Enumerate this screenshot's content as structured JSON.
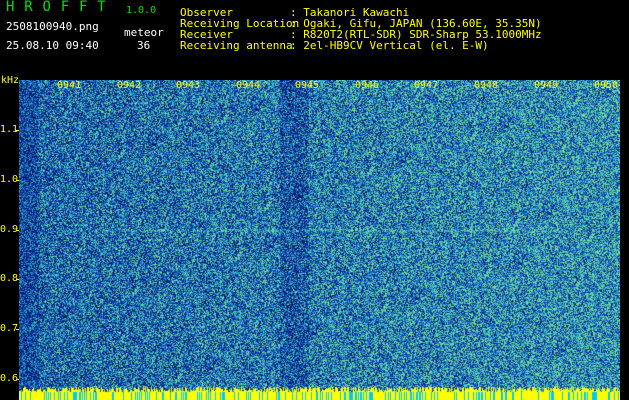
{
  "app": {
    "title": "H R O F F T",
    "version": "1.0.0",
    "filename": "2508100940.png",
    "datetime": "25.08.10 09:40",
    "meteor_label": "meteor",
    "meteor_count": "36"
  },
  "info": [
    {
      "label": "Observer",
      "value": ": Takanori Kawachi"
    },
    {
      "label": "Receiving Location",
      "value": ": Ogaki, Gifu, JAPAN (136.60E, 35.35N)"
    },
    {
      "label": "Receiver",
      "value": ": R820T2(RTL-SDR) SDR-Sharp 53.1000MHz"
    },
    {
      "label": "Receiving antenna",
      "value": ": 2el-HB9CV Vertical (el. E-W)"
    }
  ],
  "axis": {
    "unit": "kHz",
    "y_ticks": [
      "1.1",
      "1.0",
      "0.9",
      "0.8",
      "0.7",
      "0.6"
    ],
    "x_ticks": [
      "0941",
      "0942",
      "0943",
      "0944",
      "0945",
      "0946",
      "0947",
      "0948",
      "0949",
      "0950"
    ]
  },
  "colors": {
    "background": "#000000",
    "header_green": "#00e000",
    "axis_yellow": "#ffff00",
    "spectrogram_base": "#1a3ca0"
  }
}
